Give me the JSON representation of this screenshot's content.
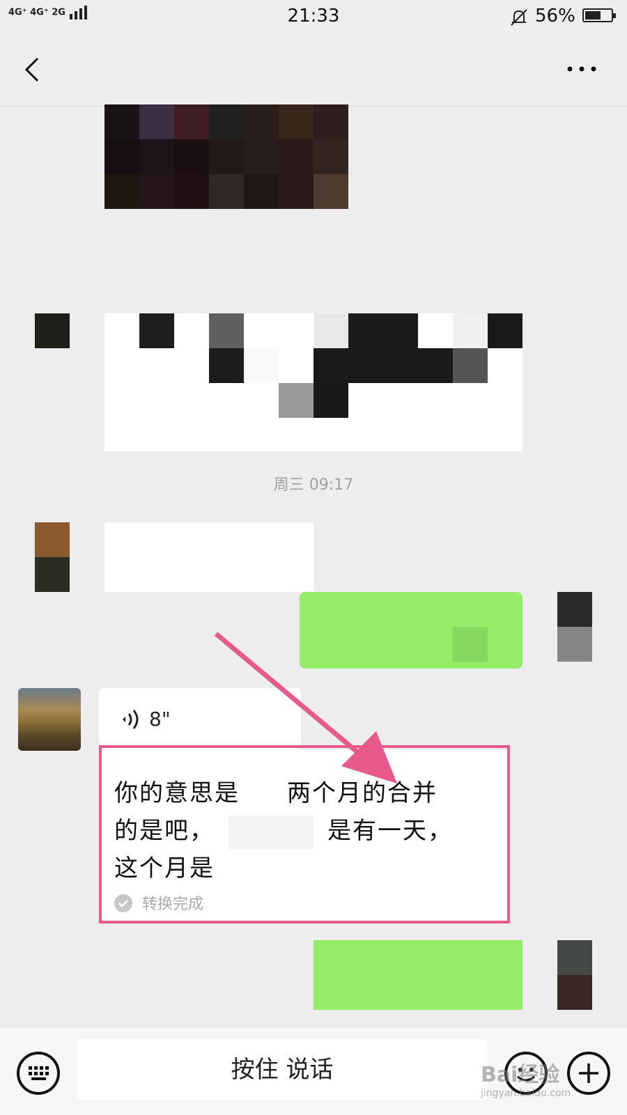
{
  "status_bar": {
    "network": "4G⁺ 4G⁺ 2G",
    "time": "21:33",
    "battery": "56%"
  },
  "header": {
    "back_icon": "chevron-left-icon",
    "more_icon": "more-icon"
  },
  "chat": {
    "timestamp": "周三 09:17",
    "voice_message": {
      "duration": "8\"",
      "transcript": "你的意思是这个是两个月的合并的是吧，就像是有一天，这个月是",
      "transcript_line1": "你的意思是",
      "transcript_line1b": "两个月的合并",
      "transcript_line2": "的是吧，",
      "transcript_line2b": "是有一天，",
      "transcript_line3": "这个月是",
      "status": "转换完成"
    }
  },
  "input_bar": {
    "talk_label": "按住 说话",
    "keyboard_icon": "keyboard-icon",
    "emoji_icon": "emoji-icon",
    "plus_icon": "plus-icon"
  },
  "watermark": {
    "text": "Bai经验",
    "sub": "jingyan.baidu.com"
  },
  "colors": {
    "background": "#ededed",
    "sent_bubble": "#95ec69",
    "highlight": "#e8598c"
  }
}
